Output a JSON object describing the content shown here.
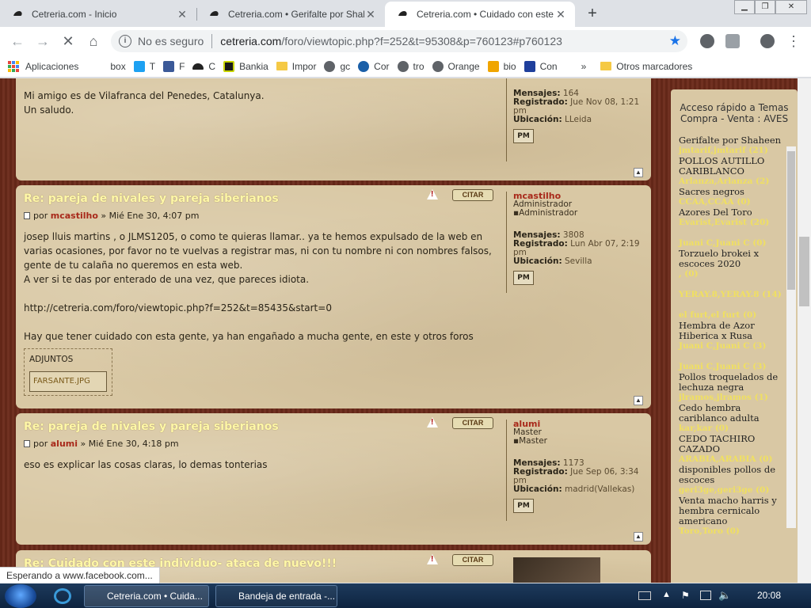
{
  "tabs": [
    {
      "title": "Cetreria.com - Inicio"
    },
    {
      "title": "Cetreria.com • Gerifalte por Shah"
    },
    {
      "title": "Cetreria.com • Cuidado con este"
    }
  ],
  "address": {
    "security": "No es seguro",
    "domain": "cetreria.com",
    "path": "/foro/viewtopic.php?f=252&t=95308&p=760123#p760123"
  },
  "bookmarks": [
    {
      "label": "Aplicaciones"
    },
    {
      "label": "box"
    },
    {
      "label": "T"
    },
    {
      "label": "F"
    },
    {
      "label": "C"
    },
    {
      "label": "Bankia"
    },
    {
      "label": "Impor"
    },
    {
      "label": "gc"
    },
    {
      "label": "Cor"
    },
    {
      "label": "tro"
    },
    {
      "label": "Orange"
    },
    {
      "label": "bio"
    },
    {
      "label": "Con"
    },
    {
      "label": "»"
    },
    {
      "label": "Otros marcadores"
    }
  ],
  "post0": {
    "lines": [
      "Mi amigo es de Vilafranca del Penedes, Catalunya.",
      "Un saludo."
    ],
    "profile": {
      "mensajes_label": "Mensajes:",
      "mensajes": "164",
      "registrado_label": "Registrado:",
      "registrado": "Jue Nov 08, 1:21 pm",
      "ubicacion_label": "Ubicación:",
      "ubicacion": "LLeida"
    }
  },
  "post1": {
    "title": "Re: pareja de nivales y pareja siberianos",
    "by": "por",
    "author": "mcastilho",
    "date": "» Mié Ene 30, 4:07 pm",
    "p1": "josep lluis martins , o JLMS1205, o como te quieras llamar.. ya te hemos expulsado de la web en varias ocasiones, por favor no te vuelvas a registrar mas, ni con tu nombre ni con nombres falsos, gente de tu calaña no queremos en esta web.",
    "p2": "A ver si te das por enterado de una vez, que pareces idiota.",
    "p3": "http://cetreria.com/foro/viewtopic.php?f=252&t=85435&start=0",
    "p4": "Hay que tener cuidado con esta gente, ya han engañado a mucha gente, en este y otros foros",
    "adjuntos": "ADJUNTOS",
    "file": "FARSANTE.JPG",
    "profile": {
      "name": "mcastilho",
      "rank": "Administrador",
      "rank_img": "Administrador",
      "mensajes_label": "Mensajes:",
      "mensajes": "3808",
      "registrado_label": "Registrado:",
      "registrado": "Lun Abr 07, 2:19 pm",
      "ubicacion_label": "Ubicación:",
      "ubicacion": "Sevilla"
    }
  },
  "post2": {
    "title": "Re: pareja de nivales y pareja siberianos",
    "by": "por",
    "author": "alumi",
    "date": "» Mié Ene 30, 4:18 pm",
    "p1": "eso es explicar las cosas claras, lo demas tonterias",
    "profile": {
      "name": "alumi",
      "rank": "Master",
      "rank_img": "Master",
      "mensajes_label": "Mensajes:",
      "mensajes": "1173",
      "registrado_label": "Registrado:",
      "registrado": "Jue Sep 06, 3:34 pm",
      "ubicacion_label": "Ubicación:",
      "ubicacion": "madrid(Vallekas)"
    }
  },
  "post3": {
    "title": "Re: Cuidado con este individuo- ataca de nuevo!!!"
  },
  "post_buttons": {
    "citar": "CITAR",
    "pm": "PM"
  },
  "sidebar": {
    "head1": "Acceso rápido a Temas",
    "head2": "Compra - Venta : AVES",
    "items": [
      {
        "title": "Gerifalte por Shaheen",
        "user": "jmtarif,jmtarif (21)"
      },
      {
        "title": "POLLOS AUTILLO CARIBLANCO",
        "user": "Arlanza,Arlanza (2)"
      },
      {
        "title": "Sacres negros",
        "user": "CCAA,CCAA (0)"
      },
      {
        "title": "Azores Del Toro",
        "user": "Evarist,Evarist (20)"
      },
      {
        "title": "",
        "user": "Juani C,Juani C (0)"
      },
      {
        "title": "Torzuelo brokei x escoces 2020",
        "user": ", (0)"
      },
      {
        "title": "",
        "user": "YERAY.8,YERAY.8 (14)"
      },
      {
        "title": "",
        "user": "el furt,el furt (0)"
      },
      {
        "title": "Hembra de Azor Hiberica x Rusa",
        "user": "Juani C,Juani C (3)"
      },
      {
        "title": "",
        "user": "Juani C,Juani C (3)"
      },
      {
        "title": "Pollos troquelados de lechuza negra",
        "user": "jlramos,jlramos (1)"
      },
      {
        "title": "Cedo hembra cariblanco adulta",
        "user": "kar,kar (0)"
      },
      {
        "title": "CEDO TACHIRO CAZADO",
        "user": "ARABIA,ARABIA (0)"
      },
      {
        "title": "disponibles pollos de escoces",
        "user": "geri3ge,geri3ge (0)"
      },
      {
        "title": "Venta macho harris y hembra cernicalo americano",
        "user": "Toro,Toro (0)"
      }
    ]
  },
  "status": "Esperando a www.facebook.com...",
  "taskbar": {
    "items": [
      {
        "label": "Cetreria.com • Cuida..."
      },
      {
        "label": "Bandeja de entrada -..."
      }
    ],
    "clock": "20:08"
  }
}
